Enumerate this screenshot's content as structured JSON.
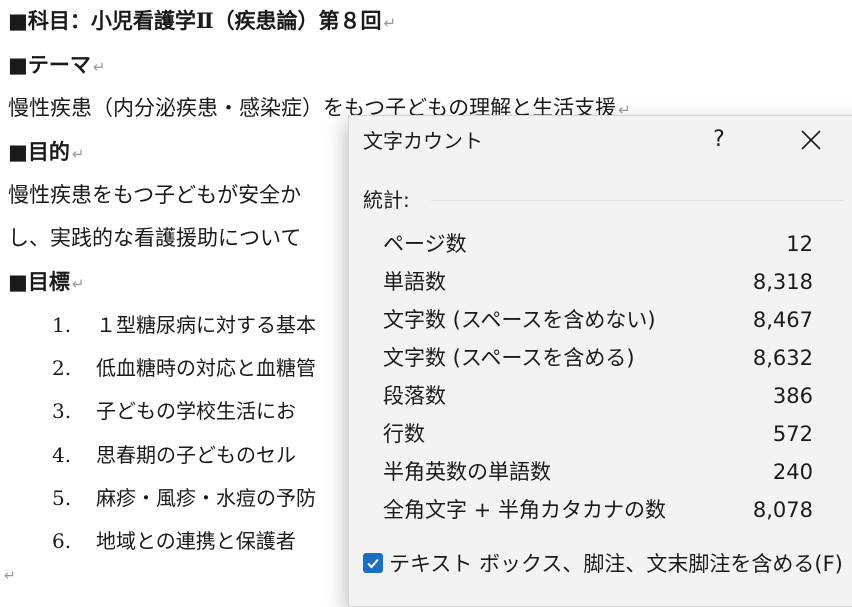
{
  "document": {
    "subject_heading": "■科目：小児看護学Ⅱ（疾患論）第８回",
    "theme_heading": "■テーマ",
    "theme_text": "慢性疾患（内分泌疾患・感染症）をもつ子どもの理解と生活支援",
    "purpose_heading": "■目的",
    "purpose_line1": "慢性疾患をもつ子どもが安全か",
    "purpose_line2": "し、実践的な看護援助について",
    "goals_heading": "■目標",
    "goals": [
      {
        "num": "1.",
        "text": "１型糖尿病に対する基本"
      },
      {
        "num": "2.",
        "text": "低血糖時の対応と血糖管"
      },
      {
        "num": "3.",
        "text": "子どもの学校生活にお"
      },
      {
        "num": "4.",
        "text": "思春期の子どものセル"
      },
      {
        "num": "5.",
        "text": "麻疹・風疹・水痘の予防"
      },
      {
        "num": "6.",
        "text": "地域との連携と保護者"
      }
    ],
    "paragraph_mark": "↵"
  },
  "dialog": {
    "title": "文字カウント",
    "help": "?",
    "stats_label": "統計:",
    "rows": [
      {
        "label": "ページ数",
        "value": "12"
      },
      {
        "label": "単語数",
        "value": "8,318"
      },
      {
        "label": "文字数 (スペースを含めない)",
        "value": "8,467"
      },
      {
        "label": "文字数 (スペースを含める)",
        "value": "8,632"
      },
      {
        "label": "段落数",
        "value": "386"
      },
      {
        "label": "行数",
        "value": "572"
      },
      {
        "label": "半角英数の単語数",
        "value": "240"
      },
      {
        "label": "全角文字 + 半角カタカナの数",
        "value": "8,078"
      }
    ],
    "checkbox_label": "テキスト ボックス、脚注、文末脚注を含める(F)",
    "checkbox_checked": true,
    "accent_color": "#1a6fc4"
  }
}
